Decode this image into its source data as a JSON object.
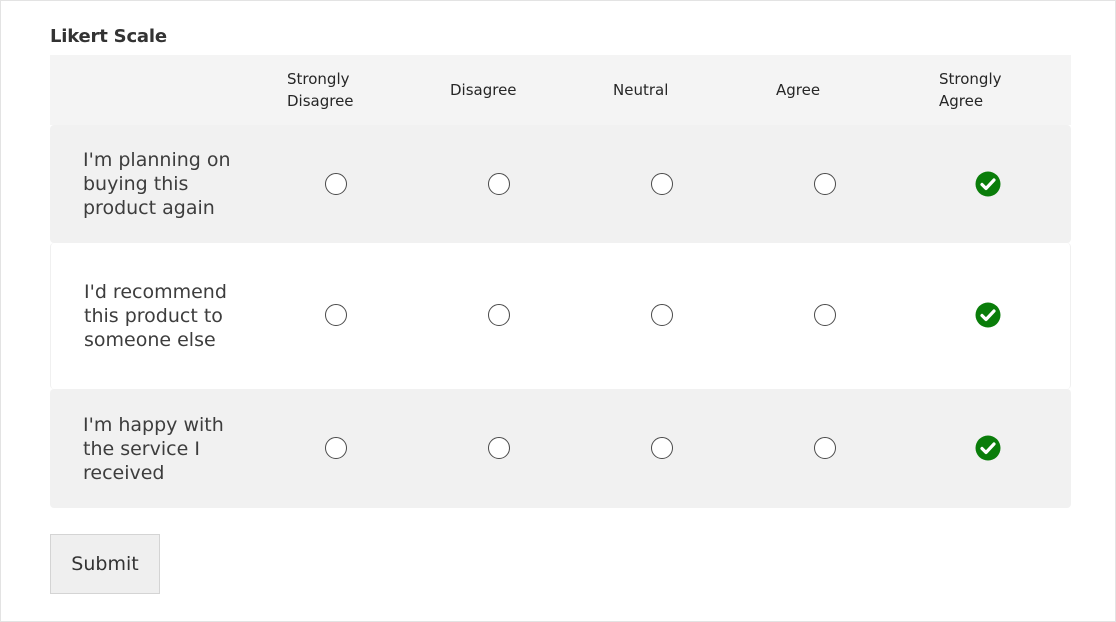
{
  "form": {
    "title": "Likert Scale",
    "submit_label": "Submit"
  },
  "columns": [
    {
      "label": "Strongly\nDisagree"
    },
    {
      "label": "Disagree"
    },
    {
      "label": "Neutral"
    },
    {
      "label": "Agree"
    },
    {
      "label": "Strongly\nAgree"
    }
  ],
  "rows": [
    {
      "statement": "I'm planning on buying this product again",
      "selected": 4
    },
    {
      "statement": "I'd recommend this product to someone else",
      "selected": 4
    },
    {
      "statement": "I'm happy with the service I received",
      "selected": 4
    }
  ],
  "colors": {
    "selected": "#0a7d0a"
  }
}
